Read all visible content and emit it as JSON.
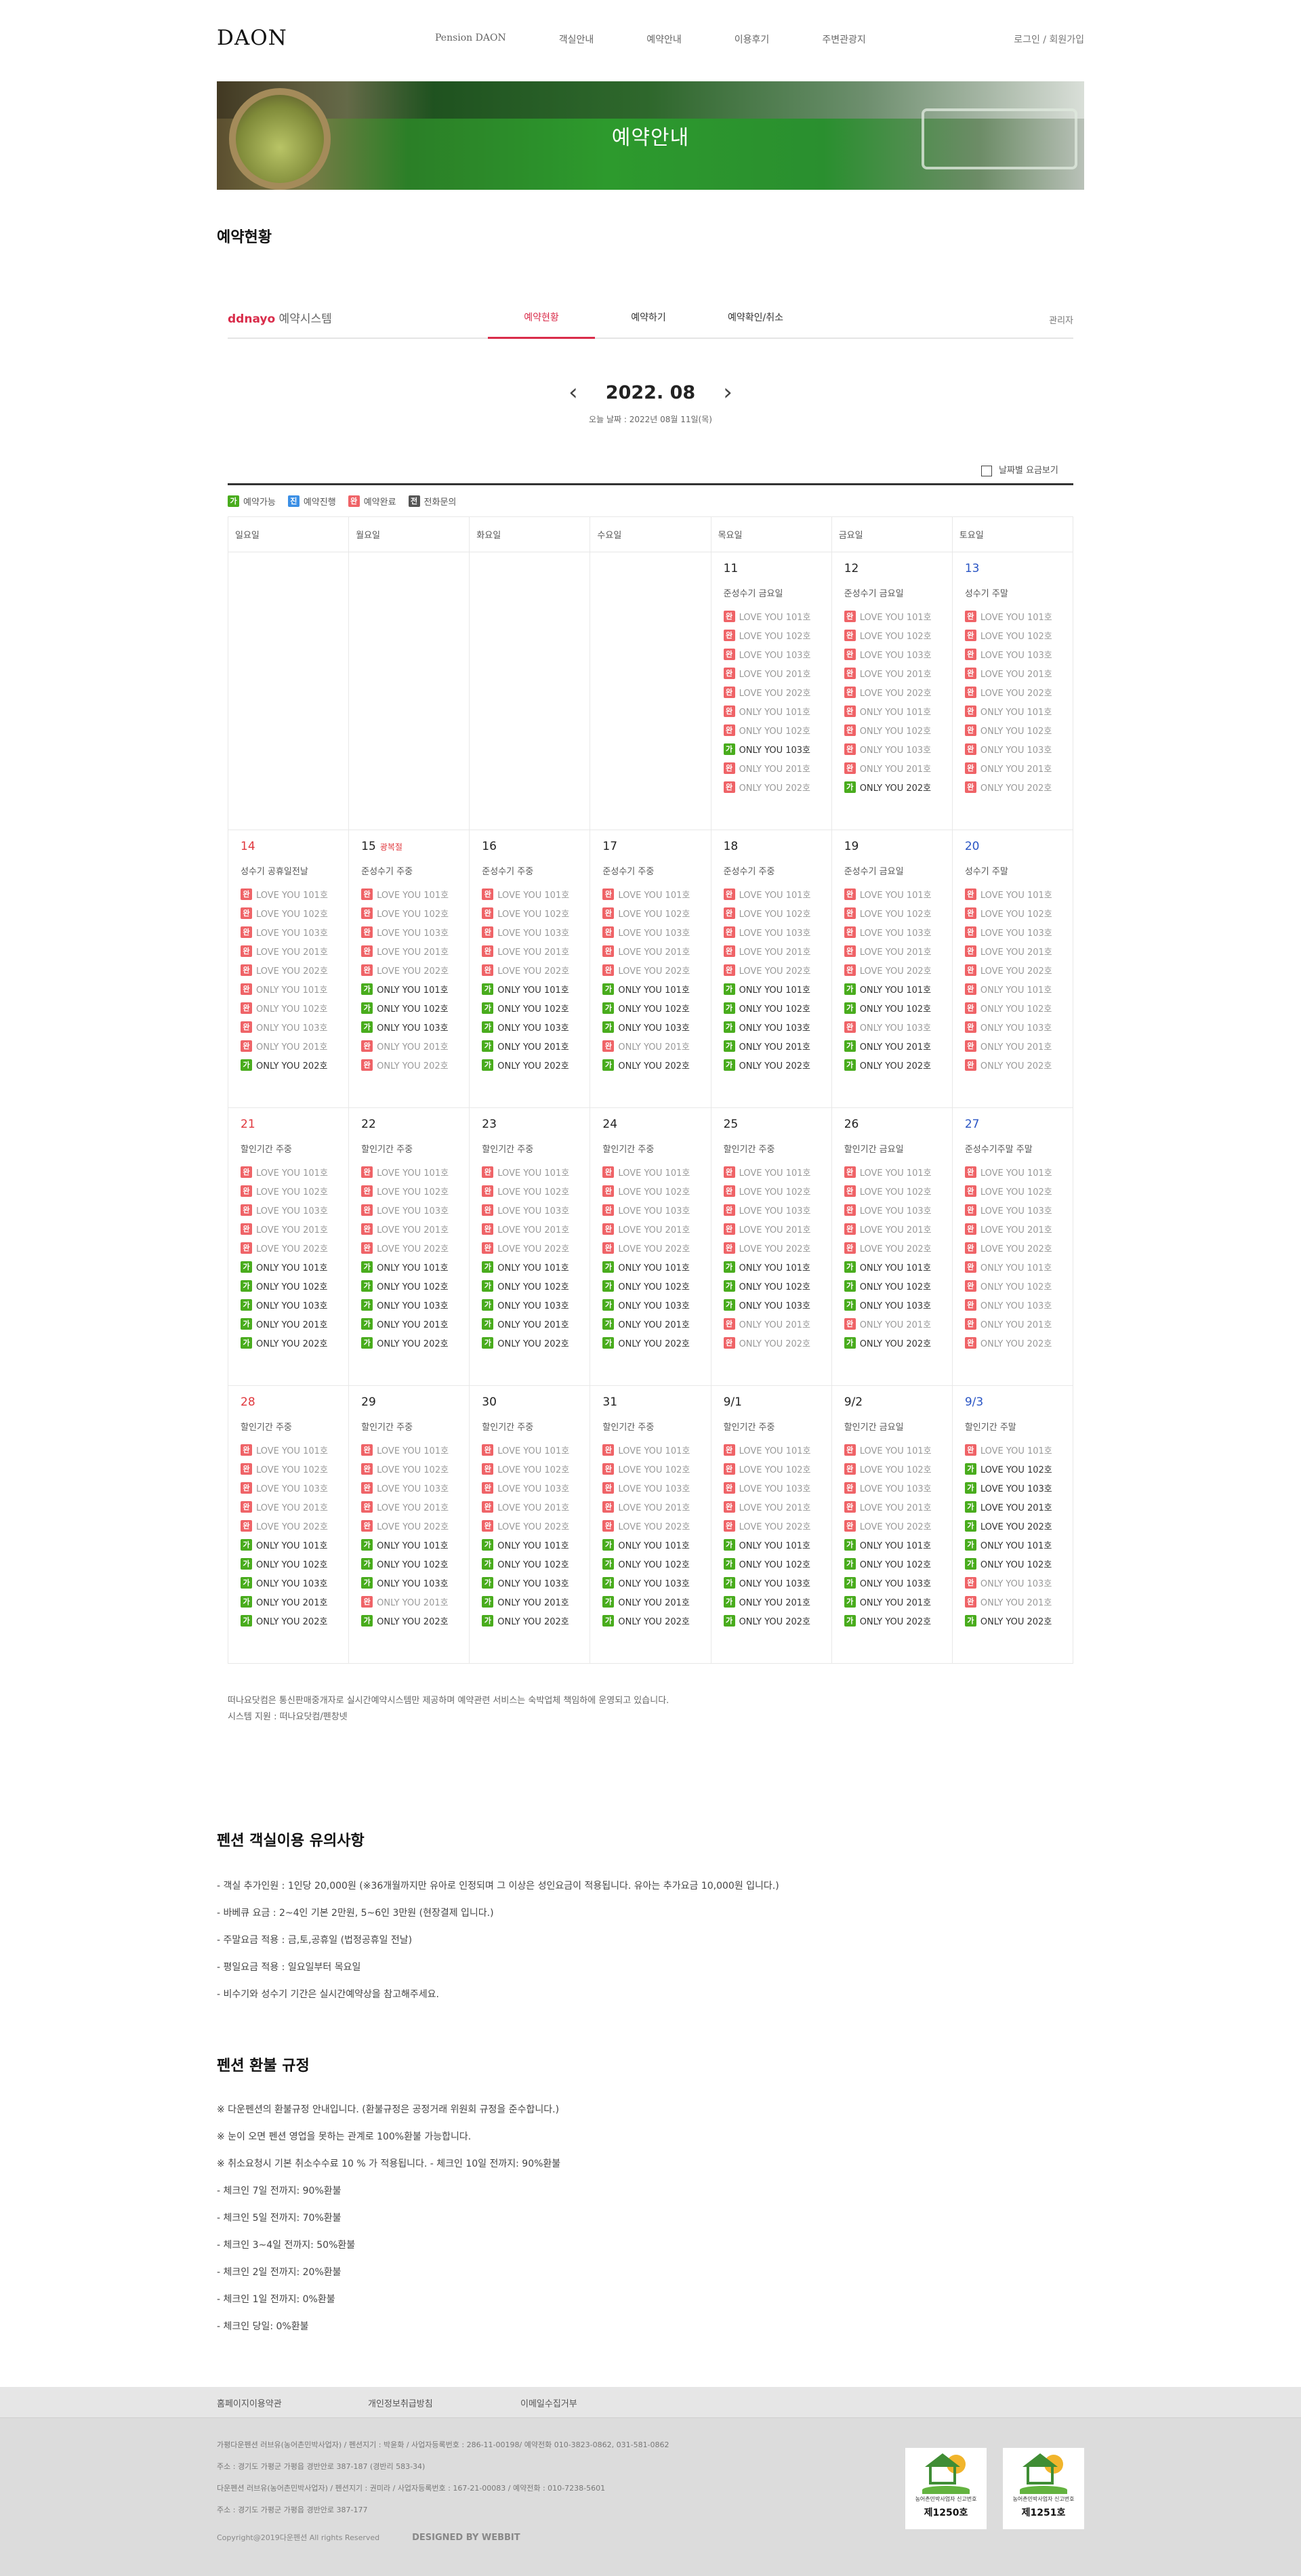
{
  "header": {
    "logo": "DAON",
    "nav": [
      "Pension DAON",
      "객실안내",
      "예약안내",
      "이용후기",
      "주변관광지"
    ],
    "util": "로그인 / 회원가입"
  },
  "banner": {
    "title": "예약안내"
  },
  "reservation": {
    "section_title": "예약현황",
    "brand_accent": "ddnayo",
    "brand_rest": " 예약시스템",
    "tabs": [
      "예약현황",
      "예약하기",
      "예약확인/취소"
    ],
    "admin": "관리자",
    "month": "2022. 08",
    "prev_icon": "chevron-left-icon",
    "next_icon": "chevron-right-icon",
    "today": "오늘 날짜 : 2022년 08월 11일(목)",
    "daily_price": "날짜별 요금보기",
    "legend": [
      {
        "b": "가",
        "t": "예약가능",
        "c": "#49ac1d"
      },
      {
        "b": "진",
        "t": "예약진행",
        "c": "#3b8fe5"
      },
      {
        "b": "완",
        "t": "예약완료",
        "c": "#ef6367"
      },
      {
        "b": "전",
        "t": "전화문의",
        "c": "#555555"
      }
    ],
    "weekdays": [
      "일요일",
      "월요일",
      "화요일",
      "수요일",
      "목요일",
      "금요일",
      "토요일"
    ],
    "rooms": [
      "LOVE YOU 101호",
      "LOVE YOU 102호",
      "LOVE YOU 103호",
      "LOVE YOU 201호",
      "LOVE YOU 202호",
      "ONLY YOU 101호",
      "ONLY YOU 102호",
      "ONLY YOU 103호",
      "ONLY YOU 201호",
      "ONLY YOU 202호"
    ],
    "weeks": [
      [
        null,
        null,
        null,
        null,
        {
          "d": "11",
          "n": "준성수기 금요일",
          "s": "wwwwwwwgww"
        },
        {
          "d": "12",
          "n": "준성수기 금요일",
          "s": "wwwwwwwwwg"
        },
        {
          "d": "13",
          "n": "성수기 주말",
          "s": "wwwwwwwwww"
        }
      ],
      [
        {
          "d": "14",
          "n": "성수기 공휴일전날",
          "s": "wwwwwwwwwg"
        },
        {
          "d": "15",
          "h": "광복절",
          "n": "준성수기 주중",
          "s": "wwwwwgggww"
        },
        {
          "d": "16",
          "n": "준성수기 주중",
          "s": "wwwwwggggg"
        },
        {
          "d": "17",
          "n": "준성수기 주중",
          "s": "wwwwwgggwg"
        },
        {
          "d": "18",
          "n": "준성수기 주중",
          "s": "wwwwwggggg"
        },
        {
          "d": "19",
          "n": "준성수기 금요일",
          "s": "wwwwwggwgg"
        },
        {
          "d": "20",
          "n": "성수기 주말",
          "s": "wwwwwwwwww"
        }
      ],
      [
        {
          "d": "21",
          "n": "할인기간 주중",
          "s": "wwwwwggggg"
        },
        {
          "d": "22",
          "n": "할인기간 주중",
          "s": "wwwwwggggg"
        },
        {
          "d": "23",
          "n": "할인기간 주중",
          "s": "wwwwwggggg"
        },
        {
          "d": "24",
          "n": "할인기간 주중",
          "s": "wwwwwggggg"
        },
        {
          "d": "25",
          "n": "할인기간 주중",
          "s": "wwwwwgggww"
        },
        {
          "d": "26",
          "n": "할인기간 금요일",
          "s": "wwwwwgggwg"
        },
        {
          "d": "27",
          "n": "준성수기주말 주말",
          "s": "wwwwwwwwww"
        }
      ],
      [
        {
          "d": "28",
          "n": "할인기간 주중",
          "s": "wwwwwggggg"
        },
        {
          "d": "29",
          "n": "할인기간 주중",
          "s": "wwwwwgggwg"
        },
        {
          "d": "30",
          "n": "할인기간 주중",
          "s": "wwwwwggggg"
        },
        {
          "d": "31",
          "n": "할인기간 주중",
          "s": "wwwwwggggg"
        },
        {
          "d": "9/1",
          "n": "할인기간 주중",
          "s": "wwwwwggggg"
        },
        {
          "d": "9/2",
          "n": "할인기간 금요일",
          "s": "wwwwwggggg"
        },
        {
          "d": "9/3",
          "n": "할인기간 주말",
          "s": "wggggggwwg"
        }
      ]
    ],
    "note": [
      "떠나요닷컴은 통신판매중개자로 실시간예약시스템만 제공하며 예약관련 서비스는 숙박업체 책임하에 운영되고 있습니다.",
      "시스템 지원 : 떠나요닷컴/펜창넷"
    ]
  },
  "notice": {
    "title": "펜션 객실이용 유의사항",
    "items": [
      "- 객실 추가인원 : 1인당 20,000원 (※36개월까지만 유아로 인정되며 그 이상은 성인요금이 적용됩니다. 유아는 추가요금 10,000원 입니다.)",
      "- 바베큐 요금 : 2~4인 기본 2만원, 5~6인 3만원 (현장결제 입니다.)",
      "- 주말요금 적용 : 금,토,공휴일 (법정공휴일 전날)",
      "- 평일요금 적용 : 일요일부터 목요일",
      "- 비수기와 성수기 기간은 실시간예약상을 참고해주세요."
    ]
  },
  "refund": {
    "title": "펜션 환불 규정",
    "items": [
      "※ 다운펜션의 환불규정 안내입니다. (환불규정은 공정거래 위원회 규정을 준수합니다.)",
      "※ 눈이 오면 펜션 영업을 못하는 관계로 100%환불 가능합니다.",
      "※ 취소요청시 기본 취소수수료 10 % 가 적용됩니다. - 체크인 10일 전까지: 90%환불",
      "- 체크인 7일 전까지: 90%환불",
      "- 체크인 5일 전까지: 70%환불",
      "- 체크인 3~4일 전까지: 50%환불",
      "- 체크인 2일 전까지: 20%환불",
      "- 체크인 1일 전까지: 0%환불",
      "- 체크인 당일: 0%환불"
    ]
  },
  "footer": {
    "links": [
      "홈페이지이용약관",
      "개인정보취급방침",
      "이메일수집거부"
    ],
    "info": [
      "가평다운펜션 러브유(농어촌민박사업자) / 펜션지기 : 박윤화 / 사업자등록번호 : 286-11-00198/ 예약전화 010-3823-0862, 031-581-0862",
      "주소 : 경기도 가평군 가평읍 경반안로 387-187 (경반리 583-34)",
      "다운펜션 러브유(농어촌민박사업자) / 펜션지기 : 권미라 / 사업자등록번호 : 167-21-00083 / 예약전화 : 010-7238-5601",
      "주소 : 경기도 가평군 가평읍 경반안로 387-177"
    ],
    "copyright": "Copyright@2019다운펜션 All rights Reserved",
    "designed": "DESIGNED BY WEBBIT",
    "certs": [
      {
        "caption": "농어촌민박사업자 신고번호",
        "num": "제1250호"
      },
      {
        "caption": "농어촌민박사업자 신고번호",
        "num": "제1251호"
      }
    ]
  }
}
